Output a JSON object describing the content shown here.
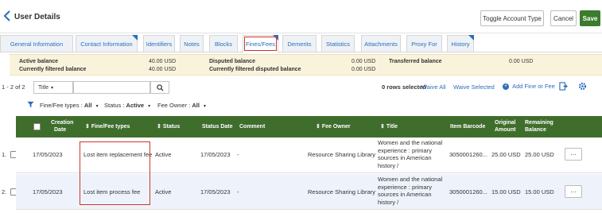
{
  "header": {
    "title": "User Details",
    "toggle_label": "Toggle Account Type",
    "cancel_label": "Cancel",
    "save_label": "Save"
  },
  "tabs": [
    {
      "label": "General Information"
    },
    {
      "label": "Contact Information"
    },
    {
      "label": "Identifiers"
    },
    {
      "label": "Notes"
    },
    {
      "label": "Blocks"
    },
    {
      "label": "Fines/Fees"
    },
    {
      "label": "Demerits"
    },
    {
      "label": "Statistics"
    },
    {
      "label": "Attachments"
    },
    {
      "label": "Proxy For"
    },
    {
      "label": "History"
    }
  ],
  "balance": {
    "active_label": "Active balance",
    "active_value": "40.00 USD",
    "filtered_label": "Currently filtered balance",
    "filtered_value": "40.00 USD",
    "disputed_label": "Disputed balance",
    "disputed_value": "0.00 USD",
    "filtered_disputed_label": "Currently filtered disputed balance",
    "filtered_disputed_value": "0.00 USD",
    "transferred_label": "Transferred balance",
    "transferred_value": "0.00 USD"
  },
  "toolbar": {
    "range": "1 - 2 of 2",
    "search_scope": "Title",
    "rows_selected": "0 rows selected",
    "waive_all": "Waive All",
    "waive_selected": "Waive Selected",
    "add_fine": "Add Fine or Fee"
  },
  "filters": {
    "type_label": "Fine/Fee types :",
    "type_value": "All",
    "status_label": "Status :",
    "status_value": "Active",
    "owner_label": "Fee Owner :",
    "owner_value": "All"
  },
  "columns": {
    "creation_date_1": "Creation",
    "creation_date_2": "Date",
    "fine_fee_types": "Fine/Fee types",
    "status": "Status",
    "status_date": "Status Date",
    "comment": "Comment",
    "fee_owner": "Fee Owner",
    "title": "Title",
    "item_barcode": "Item Barcode",
    "original_amount_1": "Original",
    "original_amount_2": "Amount",
    "remaining_balance_1": "Remaining",
    "remaining_balance_2": "Balance"
  },
  "rows": [
    {
      "num": "1.",
      "creation_date": "17/05/2023",
      "type": "Lost item replacement fee",
      "status": "Active",
      "status_date": "17/05/2023",
      "comment": "-",
      "fee_owner": "Resource Sharing Library",
      "title": "Women and the national experience : primary sources in American history /",
      "barcode": "3050001260...",
      "original_amount": "25.00 USD",
      "remaining_balance": "25.00 USD",
      "more": "···"
    },
    {
      "num": "2.",
      "creation_date": "17/05/2023",
      "type": "Lost item process fee",
      "status": "Active",
      "status_date": "17/05/2023",
      "comment": "-",
      "fee_owner": "Resource Sharing Library",
      "title": "Women and the national experience : primary sources in American history /",
      "barcode": "3050001260...",
      "original_amount": "15.00 USD",
      "remaining_balance": "15.00 USD",
      "more": "···"
    }
  ],
  "colors": {
    "accent": "#2a6ebb",
    "table_header": "#3f6e2c",
    "highlight_box": "#d0342c",
    "balance_bg": "#faf3dc"
  }
}
